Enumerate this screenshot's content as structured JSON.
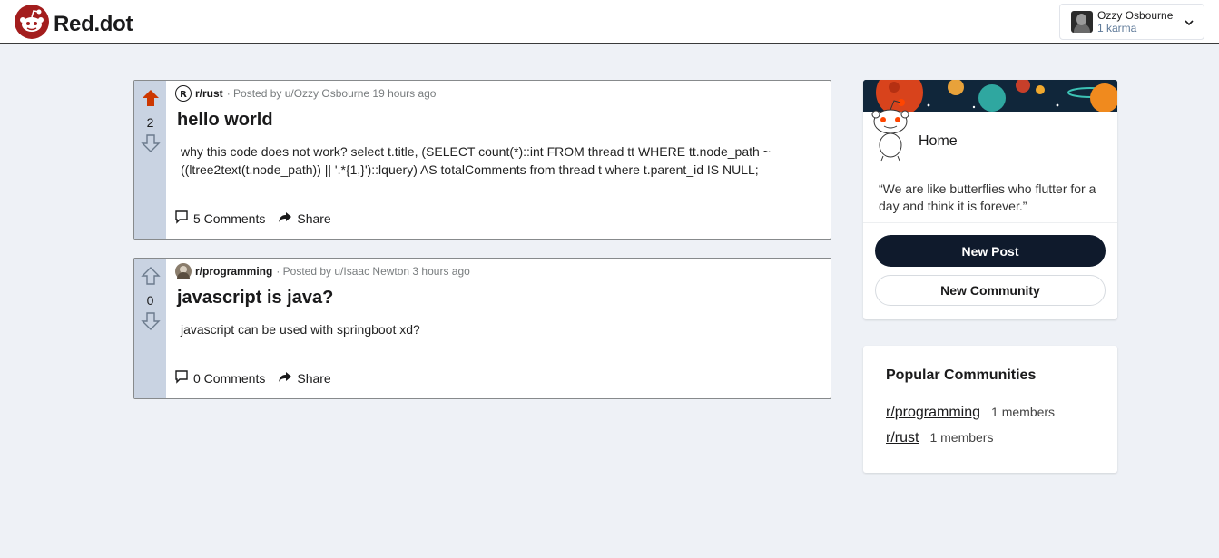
{
  "header": {
    "logo_text": "Red.dot",
    "user": {
      "name": "Ozzy Osbourne",
      "karma": "1 karma"
    }
  },
  "posts": [
    {
      "votes": "2",
      "upvoted": true,
      "subreddit": "r/rust",
      "posted_by": "· Posted by u/Ozzy Osbourne 19 hours ago",
      "title": "hello world",
      "text": "why this code does not work? select t.title, (SELECT count(*)::int FROM thread tt WHERE tt.node_path ~ ((ltree2text(t.node_path)) || '.*{1,}')::lquery) AS totalComments from thread t where t.parent_id IS NULL;",
      "comments": "5 Comments",
      "share": "Share"
    },
    {
      "votes": "0",
      "upvoted": false,
      "subreddit": "r/programming",
      "posted_by": "· Posted by u/Isaac Newton 3 hours ago",
      "title": "javascript is java?",
      "text": "javascript can be used with springboot xd?",
      "comments": "0 Comments",
      "share": "Share"
    }
  ],
  "sidebar": {
    "home_label": "Home",
    "quote": "“We are like butterflies who flutter for a day and think it is forever.”",
    "new_post": "New Post",
    "new_community": "New Community",
    "popular_title": "Popular Communities",
    "communities": [
      {
        "name": "r/programming",
        "members": "1 members"
      },
      {
        "name": "r/rust",
        "members": "1 members"
      }
    ]
  },
  "colors": {
    "upvote_active": "#cc3700",
    "vote_column": "#c9d3e2",
    "primary_button": "#0f1a2c",
    "logo_red": "#ff4500"
  }
}
